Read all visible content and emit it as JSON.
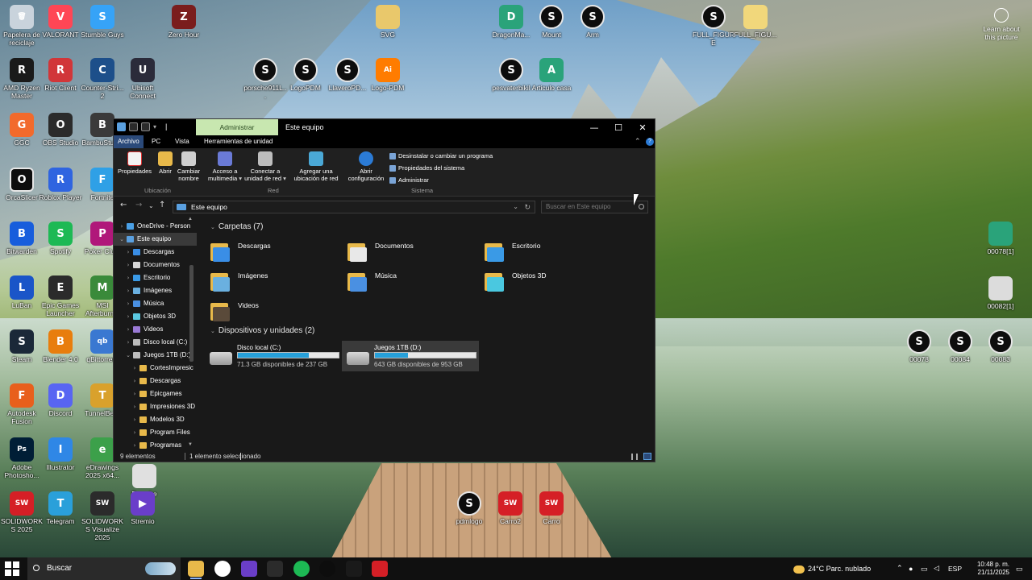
{
  "desktop": {
    "icons": [
      {
        "label": "Papelera de reciclaje",
        "color": "#c9d3dc",
        "glyph": "🗑"
      },
      {
        "label": "VALORANT",
        "color": "#ff4655",
        "glyph": "V"
      },
      {
        "label": "Stumble Guys",
        "color": "#36a3f7",
        "glyph": "S"
      },
      {
        "label": "Zero Hour",
        "color": "#7a1d1d",
        "glyph": "Z"
      },
      {
        "label": "SVG",
        "color": "#e9c86b",
        "glyph": ""
      },
      {
        "label": "DragonMa...",
        "color": "#2aa37a",
        "glyph": "D"
      },
      {
        "label": "Mount",
        "color": "#0d0d0d",
        "glyph": "S"
      },
      {
        "label": "Arm",
        "color": "#0d0d0d",
        "glyph": "S"
      },
      {
        "label": "FULL_FIGURE",
        "color": "#0d0d0d",
        "glyph": "S"
      },
      {
        "label": "FULL_FIGU...",
        "color": "#f1d77b",
        "glyph": ""
      },
      {
        "label": "AMD Ryzen Master",
        "color": "#1a1a1a",
        "glyph": "R"
      },
      {
        "label": "Riot Client",
        "color": "#d13639",
        "glyph": "R"
      },
      {
        "label": "Counter-Stri... 2",
        "color": "#1d4f8a",
        "glyph": "C"
      },
      {
        "label": "Ubisoft Connect",
        "color": "#2b2b3a",
        "glyph": "U"
      },
      {
        "label": "porsche911L...",
        "color": "#0d0d0d",
        "glyph": "S"
      },
      {
        "label": "LogoPDM",
        "color": "#0d0d0d",
        "glyph": "S"
      },
      {
        "label": "LlaveroPD...",
        "color": "#0d0d0d",
        "glyph": "S"
      },
      {
        "label": "Logo-PDM",
        "color": "#ff7c00",
        "glyph": "Ai"
      },
      {
        "label": "pesvaterbikil",
        "color": "#0d0d0d",
        "glyph": "S"
      },
      {
        "label": "Articulo casa",
        "color": "#2aa37a",
        "glyph": "A"
      },
      {
        "label": "GGC",
        "color": "#f26a2c",
        "glyph": "G"
      },
      {
        "label": "OBS Studio",
        "color": "#2b2b2b",
        "glyph": "O"
      },
      {
        "label": "BambuStudio",
        "color": "#3a3a3a",
        "glyph": "B"
      },
      {
        "label": "OrcaSlicer",
        "color": "#0d0d0d",
        "glyph": "O"
      },
      {
        "label": "Roblox Player",
        "color": "#2f64e0",
        "glyph": "R"
      },
      {
        "label": "Fortnite",
        "color": "#2fa0e6",
        "glyph": "F"
      },
      {
        "label": "Bitwarden",
        "color": "#175ddc",
        "glyph": "B"
      },
      {
        "label": "Spotify",
        "color": "#1db954",
        "glyph": "S"
      },
      {
        "label": "Poker Clu...",
        "color": "#b0187a",
        "glyph": "P"
      },
      {
        "label": "LuBan",
        "color": "#1a55c8",
        "glyph": "L"
      },
      {
        "label": "Epic Games Launcher",
        "color": "#2b2b2b",
        "glyph": "E"
      },
      {
        "label": "MSI Afterburn...",
        "color": "#3a8a3a",
        "glyph": "M"
      },
      {
        "label": "Steam",
        "color": "#1b2838",
        "glyph": "S"
      },
      {
        "label": "Blender 4.0",
        "color": "#e87d0d",
        "glyph": "B"
      },
      {
        "label": "qBittorrent",
        "color": "#3a78d1",
        "glyph": "qb"
      },
      {
        "label": "Autodesk Fusion",
        "color": "#e85f1c",
        "glyph": "F"
      },
      {
        "label": "Discord",
        "color": "#5865f2",
        "glyph": "D"
      },
      {
        "label": "TunnelBear",
        "color": "#d9a12c",
        "glyph": "T"
      },
      {
        "label": "Adobe Photosho...",
        "color": "#001e36",
        "glyph": "Ps"
      },
      {
        "label": "Illustrator",
        "color": "#2f87e6",
        "glyph": "I"
      },
      {
        "label": "eDrawings 2025 x64...",
        "color": "#3ca04a",
        "glyph": "e"
      },
      {
        "label": "Porsche 911...",
        "color": "#e0e0e0",
        "glyph": ""
      },
      {
        "label": "SOLIDWORKS 2025",
        "color": "#d51f26",
        "glyph": "SW"
      },
      {
        "label": "Telegram",
        "color": "#2aa0da",
        "glyph": "T"
      },
      {
        "label": "SOLIDWORKS Visualize 2025",
        "color": "#2b2b2b",
        "glyph": "SW"
      },
      {
        "label": "Stremio",
        "color": "#6a3ec9",
        "glyph": "▶"
      },
      {
        "label": "pdmlogo",
        "color": "#0d0d0d",
        "glyph": "S"
      },
      {
        "label": "Carro2",
        "color": "#d51f26",
        "glyph": "SW"
      },
      {
        "label": "Carro",
        "color": "#d51f26",
        "glyph": "SW"
      },
      {
        "label": "00078[1]",
        "color": "#2aa37a",
        "glyph": ""
      },
      {
        "label": "00082[1]",
        "color": "#dcdcdc",
        "glyph": ""
      },
      {
        "label": "00078",
        "color": "#0d0d0d",
        "glyph": "S"
      },
      {
        "label": "00084",
        "color": "#0d0d0d",
        "glyph": "S"
      },
      {
        "label": "00083",
        "color": "#0d0d0d",
        "glyph": "S"
      }
    ],
    "learn_about": "Learn about this picture"
  },
  "explorer": {
    "quick_access_separator": "|",
    "contextual_tab": "Administrar",
    "title": "Este equipo",
    "ribbon_tabs": [
      "Archivo",
      "PC",
      "Vista",
      "Herramientas de unidad"
    ],
    "ribbon_buttons": {
      "properties": "Propiedades",
      "open": "Abrir",
      "rename": "Cambiar nombre",
      "media": "Acceso a multimedia",
      "map_drive": "Conectar a unidad de red",
      "add_location": "Agregar una ubicación de red",
      "settings": "Abrir configuración",
      "uninstall": "Desinstalar o cambiar un programa",
      "system_props": "Propiedades del sistema",
      "manage": "Administrar"
    },
    "ribbon_groups": [
      "Ubicación",
      "Red",
      "Sistema"
    ],
    "address": "Este equipo",
    "search_placeholder": "Buscar en Este equipo",
    "nav": [
      {
        "label": "OneDrive - Person",
        "indent": 0,
        "color": "#4aa0e6",
        "selected": false
      },
      {
        "label": "Este equipo",
        "indent": 0,
        "color": "#5aa0e0",
        "selected": true
      },
      {
        "label": "Descargas",
        "indent": 1,
        "color": "#3a8ee6",
        "selected": false
      },
      {
        "label": "Documentos",
        "indent": 1,
        "color": "#d7d7d7",
        "selected": false
      },
      {
        "label": "Escritorio",
        "indent": 1,
        "color": "#3a9ae6",
        "selected": false
      },
      {
        "label": "Imágenes",
        "indent": 1,
        "color": "#6ab0e0",
        "selected": false
      },
      {
        "label": "Música",
        "indent": 1,
        "color": "#4a90e2",
        "selected": false
      },
      {
        "label": "Objetos 3D",
        "indent": 1,
        "color": "#5ac8e0",
        "selected": false
      },
      {
        "label": "Videos",
        "indent": 1,
        "color": "#9a7ad6",
        "selected": false
      },
      {
        "label": "Disco local (C:)",
        "indent": 1,
        "color": "#bdbdbd",
        "selected": false
      },
      {
        "label": "Juegos 1TB (D:)",
        "indent": 1,
        "color": "#bdbdbd",
        "selected": false
      },
      {
        "label": "CortesImpresic",
        "indent": 2,
        "color": "#e8b94a",
        "selected": false
      },
      {
        "label": "Descargas",
        "indent": 2,
        "color": "#e8b94a",
        "selected": false
      },
      {
        "label": "Epicgames",
        "indent": 2,
        "color": "#e8b94a",
        "selected": false
      },
      {
        "label": "Impresiones 3D",
        "indent": 2,
        "color": "#e8b94a",
        "selected": false
      },
      {
        "label": "Modelos 3D",
        "indent": 2,
        "color": "#e8b94a",
        "selected": false
      },
      {
        "label": "Program Files",
        "indent": 2,
        "color": "#e8b94a",
        "selected": false
      },
      {
        "label": "Programas",
        "indent": 2,
        "color": "#e8b94a",
        "selected": false
      }
    ],
    "folders_header": "Carpetas (7)",
    "folders": [
      {
        "name": "Descargas",
        "accent": "#3a8ee6"
      },
      {
        "name": "Documentos",
        "accent": "#e8e8e8"
      },
      {
        "name": "Escritorio",
        "accent": "#3a9ae6"
      },
      {
        "name": "Imágenes",
        "accent": "#6ab0e0"
      },
      {
        "name": "Música",
        "accent": "#4a90e2"
      },
      {
        "name": "Objetos 3D",
        "accent": "#4ac8e0"
      },
      {
        "name": "Videos",
        "accent": "#5a4a3a"
      }
    ],
    "devices_header": "Dispositivos y unidades (2)",
    "drives": [
      {
        "name": "Disco local (C:)",
        "free": "71.3 GB disponibles de 237 GB",
        "used_fraction": 0.7
      },
      {
        "name": "Juegos 1TB (D:)",
        "free": "643 GB disponibles de 953 GB",
        "used_fraction": 0.33
      }
    ],
    "status": {
      "count": "9 elementos",
      "selected": "1 elemento seleccionado"
    }
  },
  "taskbar": {
    "search": "Buscar",
    "weather": "24°C  Parc. nublado",
    "language": "ESP",
    "time": "10:48 p. m.",
    "date": "21/11/2025",
    "apps": [
      {
        "name": "file-explorer",
        "color": "#e8b94a"
      },
      {
        "name": "chrome",
        "color": "#ffffff"
      },
      {
        "name": "app-purple",
        "color": "#6a3ec9"
      },
      {
        "name": "epic-games",
        "color": "#2b2b2b"
      },
      {
        "name": "spotify",
        "color": "#1db954"
      },
      {
        "name": "orca-slicer",
        "color": "#0d0d0d"
      },
      {
        "name": "app-dark",
        "color": "#1a1a1a"
      },
      {
        "name": "app-red",
        "color": "#d51f26"
      }
    ]
  }
}
